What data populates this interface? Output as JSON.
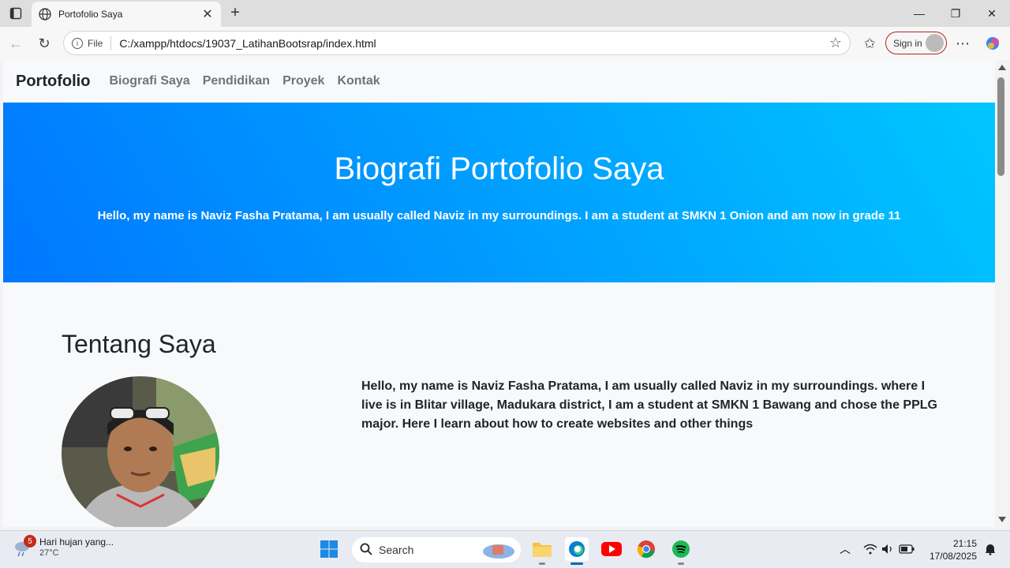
{
  "browser": {
    "tab_title": "Portofolio Saya",
    "new_tab_symbol": "+",
    "address_chip": "File",
    "url": "C:/xampp/htdocs/19037_LatihanBootsrap/index.html",
    "sign_in_label": "Sign in"
  },
  "navbar": {
    "brand": "Portofolio",
    "links": [
      "Biografi Saya",
      "Pendidikan",
      "Proyek",
      "Kontak"
    ]
  },
  "hero": {
    "title": "Biografi Portofolio Saya",
    "subtitle": "Hello, my name is Naviz Fasha Pratama, I am usually called Naviz in my surroundings. I am a student at SMKN 1 Onion and am now in grade 11"
  },
  "about": {
    "heading": "Tentang Saya",
    "text": "Hello, my name is Naviz Fasha Pratama, I am usually called Naviz in my surroundings. where I live is in Blitar village, Madukara district, I am a student at SMKN 1 Bawang and chose the PPLG major. Here I learn about how to create websites and other things"
  },
  "taskbar": {
    "weather_badge": "5",
    "weather_text": "Hari hujan yang...",
    "weather_temp": "27°C",
    "search_placeholder": "Search",
    "time": "21:15",
    "date": "17/08/2025"
  },
  "colors": {
    "hero_gradient_start": "#0077ff",
    "hero_gradient_end": "#00c6ff",
    "signin_border": "#b3261e"
  }
}
